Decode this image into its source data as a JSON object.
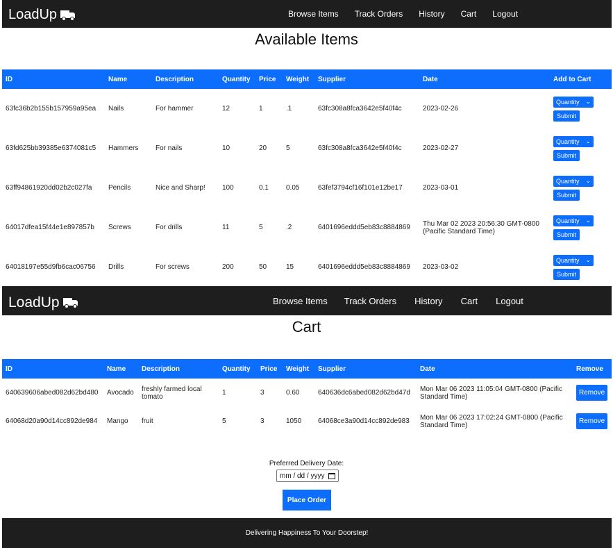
{
  "brand": "LoadUp",
  "nav": [
    "Browse Items",
    "Track Orders",
    "History",
    "Cart",
    "Logout"
  ],
  "items_section": {
    "title": "Available Items",
    "columns": [
      "ID",
      "Name",
      "Description",
      "Quantity",
      "Price",
      "Weight",
      "Supplier",
      "Date",
      "Add to Cart"
    ],
    "quantity_placeholder": "Quantity",
    "submit_label": "Submit",
    "rows": [
      {
        "id": "63fc36b2b155b157959a95ea",
        "name": "Nails",
        "description": "For hammer",
        "quantity": "12",
        "price": "1",
        "weight": ".1",
        "supplier": "63fc308a8fca3642e5f40f4c",
        "date": "2023-02-26"
      },
      {
        "id": "63fd625bb39385e6374081c5",
        "name": "Hammers",
        "description": "For nails",
        "quantity": "10",
        "price": "20",
        "weight": "5",
        "supplier": "63fc308a8fca3642e5f40f4c",
        "date": "2023-02-27"
      },
      {
        "id": "63ff94861920dd02b2c027fa",
        "name": "Pencils",
        "description": "Nice and Sharp!",
        "quantity": "100",
        "price": "0.1",
        "weight": "0.05",
        "supplier": "63fef3794cf16f101e12be17",
        "date": "2023-03-01"
      },
      {
        "id": "64017dfea15f44e1e897857b",
        "name": "Screws",
        "description": "For drills",
        "quantity": "11",
        "price": "5",
        "weight": ".2",
        "supplier": "6401696eddd5eb83c8884869",
        "date": "Thu Mar 02 2023 20:56:30 GMT-0800 (Pacific Standard Time)"
      },
      {
        "id": "64018197e55d9fb6cac06756",
        "name": "Drills",
        "description": "For screws",
        "quantity": "200",
        "price": "50",
        "weight": "15",
        "supplier": "6401696eddd5eb83c8884869",
        "date": "2023-03-02"
      }
    ]
  },
  "cart_section": {
    "title": "Cart",
    "columns": [
      "ID",
      "Name",
      "Description",
      "Quantity",
      "Price",
      "Weight",
      "Supplier",
      "Date",
      "Remove"
    ],
    "remove_label": "Remove",
    "rows": [
      {
        "id": "640639606abed082d62bd480",
        "name": "Avocado",
        "description": "freshly farmed local tomato",
        "quantity": "1",
        "price": "3",
        "weight": "0.60",
        "supplier": "640636dc6abed082d62bd47d",
        "date": "Mon Mar 06 2023 11:05:04 GMT-0800 (Pacific Standard Time)"
      },
      {
        "id": "64068d20a90d14cc892de984",
        "name": "Mango",
        "description": "fruit",
        "quantity": "5",
        "price": "3",
        "weight": "1050",
        "supplier": "64068ce3a90d14cc892de983",
        "date": "Mon Mar 06 2023 17:02:24 GMT-0800 (Pacific Standard Time)"
      }
    ],
    "delivery_label": "Preferred Delivery Date:",
    "date_placeholder": "mm / dd / yyyy",
    "place_order_label": "Place Order"
  },
  "footer": "Delivering Happiness To Your Doorstep!",
  "colors": {
    "primary": "#0d6efd",
    "navbar": "#1e1e1e"
  }
}
